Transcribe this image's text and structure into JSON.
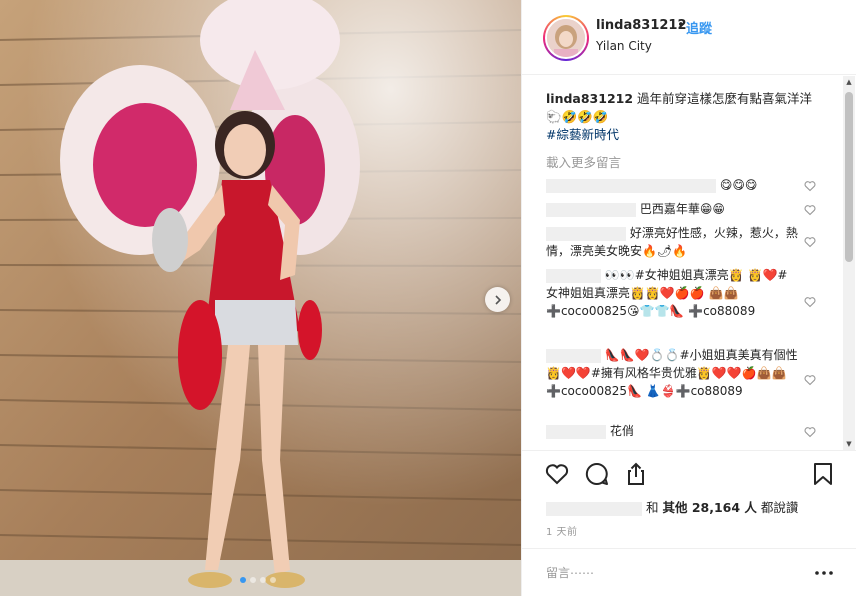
{
  "post": {
    "username": "linda831212",
    "dot": "•",
    "follow_label": "追蹤",
    "location": "Yilan City"
  },
  "caption": {
    "username": "linda831212",
    "text": "過年前穿這樣怎麼有點喜氣洋洋🐑🤣🤣🤣",
    "hashtag": "#綜藝新時代"
  },
  "load_more_label": "載入更多留言",
  "comments": [
    {
      "text": "😋😋😋"
    },
    {
      "text": "巴西嘉年華😁😁"
    },
    {
      "text": "好漂亮好性感，火辣，惹火，熱情，漂亮美女晚安🔥🌶🔥"
    },
    {
      "text": "👀👀#女神姐姐真漂亮👸 👸❤️#女神姐姐真漂亮👸👸❤️🍎🍎 👜👜➕coco00825😘👕👕👠 ➕co88089"
    },
    {
      "text": "👠👠❤️💍💍#小姐姐真美真有個性👸❤️❤️#擁有风格华贵优雅👸❤️❤️🍎👜👜➕coco00825👠 👗👙➕co88089"
    },
    {
      "text": "花俏"
    }
  ],
  "likes": {
    "prefix": "和 ",
    "count_text": "其他 28,164 人",
    "suffix": " 都說讚"
  },
  "time_ago": "1 天前",
  "comment_input": {
    "placeholder": "留言⋯⋯"
  },
  "colors": {
    "accent": "#3897f0",
    "hashtag": "#003569",
    "muted": "#999999"
  },
  "icons": [
    "heart-icon",
    "comment-icon",
    "share-icon",
    "bookmark-icon",
    "more-icon",
    "chevron-right-icon"
  ]
}
